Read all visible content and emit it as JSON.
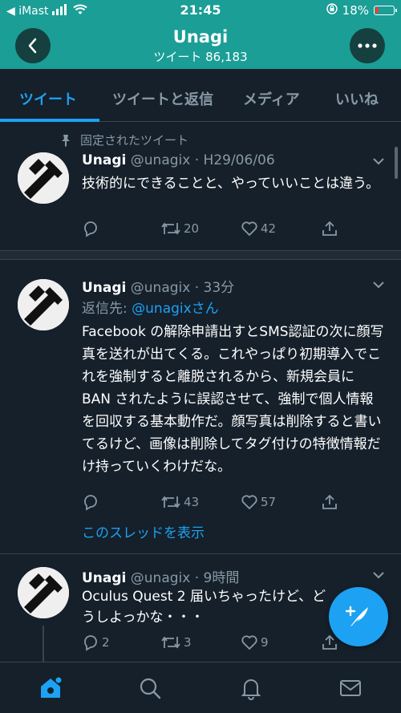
{
  "status_bar": {
    "carrier": "◀ iMast",
    "time": "21:45",
    "battery": "18%"
  },
  "header": {
    "title": "Unagi",
    "subtitle": "ツイート 86,183"
  },
  "tabs": [
    {
      "label": "ツイート",
      "active": true
    },
    {
      "label": "ツイートと返信",
      "active": false
    },
    {
      "label": "メディア",
      "active": false
    },
    {
      "label": "いいね",
      "active": false
    }
  ],
  "tweets": [
    {
      "pinned_label": "固定されたツイート",
      "name": "Unagi",
      "handle": "@unagix",
      "time": "· H29/06/06",
      "text": "技術的にできることと、やっていいことは違う。",
      "retweets": "20",
      "likes": "42"
    },
    {
      "name": "Unagi",
      "handle": "@unagix",
      "time": "· 33分",
      "reply_prefix": "返信先: ",
      "reply_to": "@unagixさん",
      "text": "Facebook の解除申請出すとSMS認証の次に顔写真を送れが出てくる。これやっぱり初期導入でこれを強制すると離脱されるから、新規会員に BAN されたように誤認させて、強制で個人情報を回収する基本動作だ。顔写真は削除すると書いてるけど、画像は削除してタグ付けの特徴情報だけ持っていくわけだな。",
      "retweets": "43",
      "likes": "57",
      "thread_link": "このスレッドを表示"
    },
    {
      "name": "Unagi",
      "handle": "@unagix",
      "time": "· 9時間",
      "text": "Oculus Quest 2 届いちゃったけど、どうしよっかな・・・",
      "replies": "2",
      "retweets": "3",
      "likes": "9"
    }
  ],
  "colors": {
    "header_bg": "#1a9e96",
    "page_bg": "#15202b",
    "accent": "#1da1f2",
    "muted": "#8899a6"
  },
  "icons": {
    "back": "chevron-left-icon",
    "more": "more-icon",
    "compose": "feather-plus-icon",
    "home": "home-icon",
    "search": "search-icon",
    "notifications": "bell-icon",
    "messages": "mail-icon"
  }
}
